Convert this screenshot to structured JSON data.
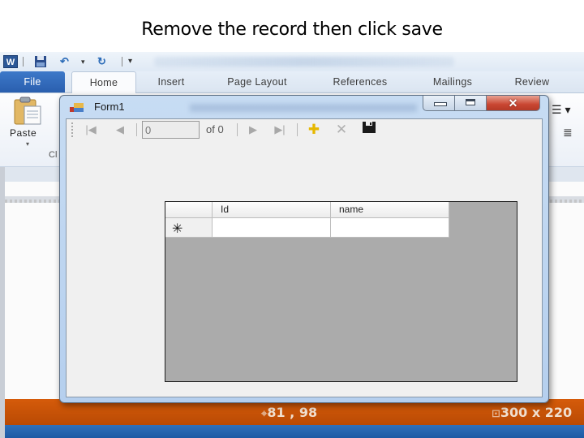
{
  "slide": {
    "title": "Remove the record then click save"
  },
  "word": {
    "quick_access": {
      "logo": "W",
      "save_icon": "save-icon",
      "undo_icon": "undo-icon",
      "undo_dropdown": "▾",
      "redo_icon": "redo-icon",
      "customize": "▾"
    },
    "tabs": [
      {
        "label": "File"
      },
      {
        "label": "Home"
      },
      {
        "label": "Insert"
      },
      {
        "label": "Page Layout"
      },
      {
        "label": "References"
      },
      {
        "label": "Mailings"
      },
      {
        "label": "Review"
      }
    ],
    "ribbon": {
      "paste_label": "Paste",
      "paste_dropdown": "▾",
      "group_label": "Cl",
      "para_icon_1": "☰  ▾",
      "para_icon_2": "≣"
    },
    "status_bar": {
      "position": "81 , 98",
      "size": "300 x 220"
    }
  },
  "form": {
    "title": "Form1",
    "window_buttons": {
      "minimize": "",
      "maximize": "",
      "close": "✕"
    },
    "navigator": {
      "move_first": "|◀",
      "move_previous": "◀",
      "position_value": "0",
      "count_label": "of 0",
      "move_next": "▶",
      "move_last": "▶|",
      "add_new": "✚",
      "delete": "✕",
      "save": "💾"
    },
    "grid": {
      "columns": [
        "Id",
        "name"
      ],
      "new_row_marker": "✳",
      "rows": [
        {
          "Id": "",
          "name": ""
        }
      ]
    }
  }
}
